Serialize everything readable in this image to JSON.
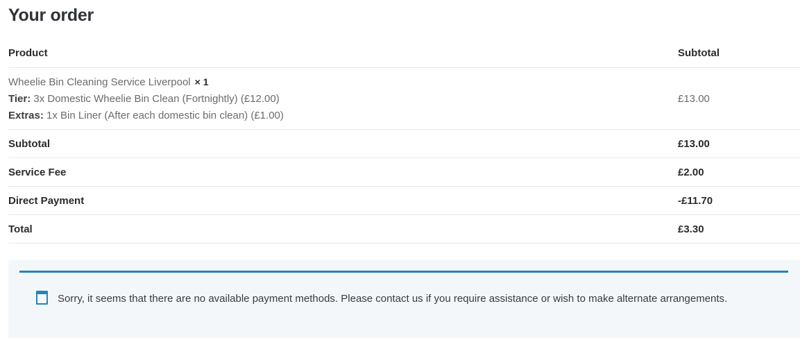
{
  "heading": "Your order",
  "table": {
    "columns": [
      "Product",
      "Subtotal"
    ],
    "item": {
      "name": "Wheelie Bin Cleaning Service Liverpool",
      "quantity": "× 1",
      "meta": [
        {
          "key": "Tier:",
          "value": "3x Domestic Wheelie Bin Clean (Fortnightly) (£12.00)"
        },
        {
          "key": "Extras:",
          "value": "1x Bin Liner (After each domestic bin clean) (£1.00)"
        }
      ],
      "subtotal": "£13.00"
    },
    "totals": [
      {
        "label": "Subtotal",
        "value": "£13.00"
      },
      {
        "label": "Service Fee",
        "value": "£2.00"
      },
      {
        "label": "Direct Payment",
        "value": "-£11.70"
      },
      {
        "label": "Total",
        "value": "£3.30"
      }
    ]
  },
  "notice": {
    "icon": "info-window-icon",
    "text": "Sorry, it seems that there are no available payment methods. Please contact us if you require assistance or wish to make alternate arrangements.",
    "accent": "#1e85be"
  }
}
